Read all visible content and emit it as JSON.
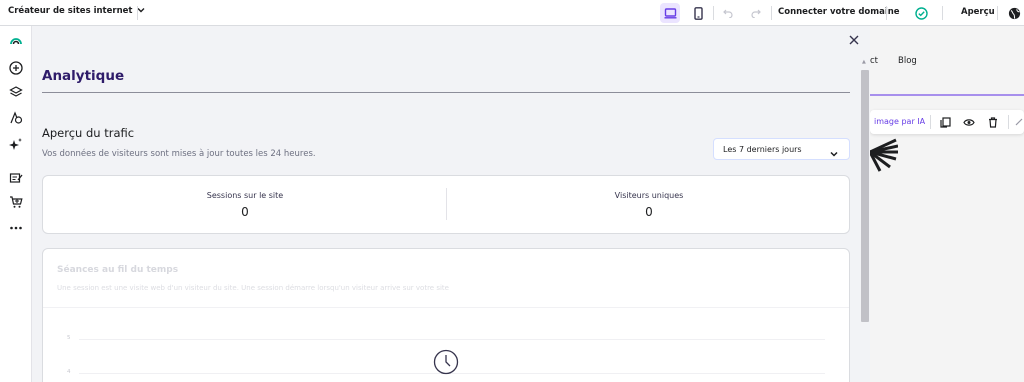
{
  "topbar": {
    "brand": "Créateur de sites internet",
    "connect_domain": "Connecter votre domaine",
    "preview": "Aperçu",
    "icons": [
      "chevron-down-icon",
      "desktop-icon",
      "mobile-icon",
      "undo-icon",
      "redo-icon",
      "check-circle-icon",
      "globe-icon"
    ]
  },
  "rail": {
    "icons": [
      "logo-icon",
      "add-icon",
      "layers-icon",
      "styles-icon",
      "ai-sparkle-icon",
      "blog-icon",
      "store-icon",
      "more-icon"
    ]
  },
  "canvas": {
    "nav_partial": "ct",
    "nav_blog": "Blog",
    "toolbar_ai": "image par IA",
    "toolbar_icons": [
      "duplicate-icon",
      "eye-icon",
      "trash-icon",
      "arrow-icon"
    ]
  },
  "modal": {
    "title": "Analytique",
    "section_title": "Aperçu du trafic",
    "section_subtitle": "Vos données de visiteurs sont mises à jour toutes les 24 heures.",
    "period_select": "Les 7 derniers jours",
    "stats": [
      {
        "label": "Sessions sur le site",
        "value": "0"
      },
      {
        "label": "Visiteurs uniques",
        "value": "0"
      }
    ],
    "chart_title": "Séances au fil du temps",
    "chart_subtitle": "Une session est une visite web d'un visiteur du site. Une session démarre lorsqu'un visiteur arrive sur votre site",
    "y_ticks": [
      "5",
      "4"
    ]
  },
  "colors": {
    "accent": "#673de6",
    "success": "#00b090",
    "title": "#2f1c6a"
  }
}
